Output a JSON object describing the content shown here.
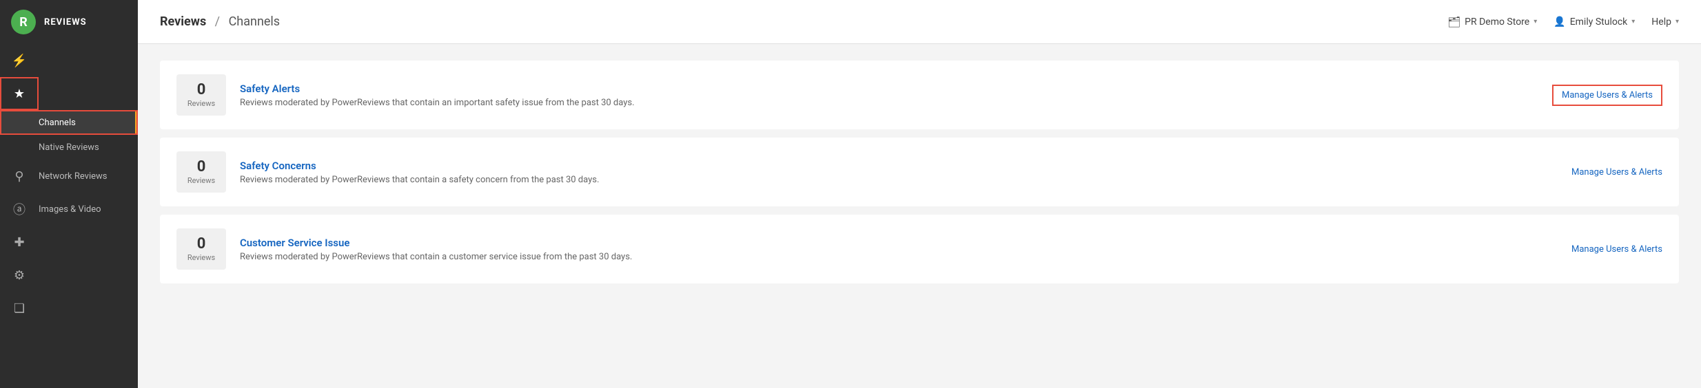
{
  "sidebar": {
    "logo_letter": "R",
    "title": "REVIEWS",
    "icons": [
      {
        "name": "activity-icon",
        "symbol": "⚡",
        "active": false
      },
      {
        "name": "star-icon",
        "symbol": "★",
        "active": true
      },
      {
        "name": "search-icon",
        "symbol": "🔍",
        "active": false
      },
      {
        "name": "camera-icon",
        "symbol": "📷",
        "active": false
      },
      {
        "name": "plus-icon",
        "symbol": "✚",
        "active": false
      },
      {
        "name": "settings-icon",
        "symbol": "⚙",
        "active": false
      },
      {
        "name": "copy-icon",
        "symbol": "❏",
        "active": false
      }
    ],
    "nav_items": [
      {
        "label": "Channels",
        "active": true,
        "highlighted": true
      },
      {
        "label": "Native Reviews",
        "active": false,
        "highlighted": false
      },
      {
        "label": "Network Reviews",
        "active": false,
        "highlighted": false
      },
      {
        "label": "Images & Video",
        "active": false,
        "highlighted": false
      }
    ]
  },
  "header": {
    "breadcrumb_link": "Reviews",
    "breadcrumb_separator": "/",
    "breadcrumb_current": "Channels",
    "store_icon": "🗂",
    "store_name": "PR Demo Store",
    "user_name": "Emily Stulock",
    "help_label": "Help"
  },
  "channels": [
    {
      "count": "0",
      "count_label": "Reviews",
      "name": "Safety Alerts",
      "description": "Reviews moderated by PowerReviews that contain an important safety issue from the past 30 days.",
      "manage_label": "Manage Users & Alerts",
      "manage_highlighted": true
    },
    {
      "count": "0",
      "count_label": "Reviews",
      "name": "Safety Concerns",
      "description": "Reviews moderated by PowerReviews that contain a safety concern from the past 30 days.",
      "manage_label": "Manage Users & Alerts",
      "manage_highlighted": false
    },
    {
      "count": "0",
      "count_label": "Reviews",
      "name": "Customer Service Issue",
      "description": "Reviews moderated by PowerReviews that contain a customer service issue from the past 30 days.",
      "manage_label": "Manage Users & Alerts",
      "manage_highlighted": false
    }
  ]
}
